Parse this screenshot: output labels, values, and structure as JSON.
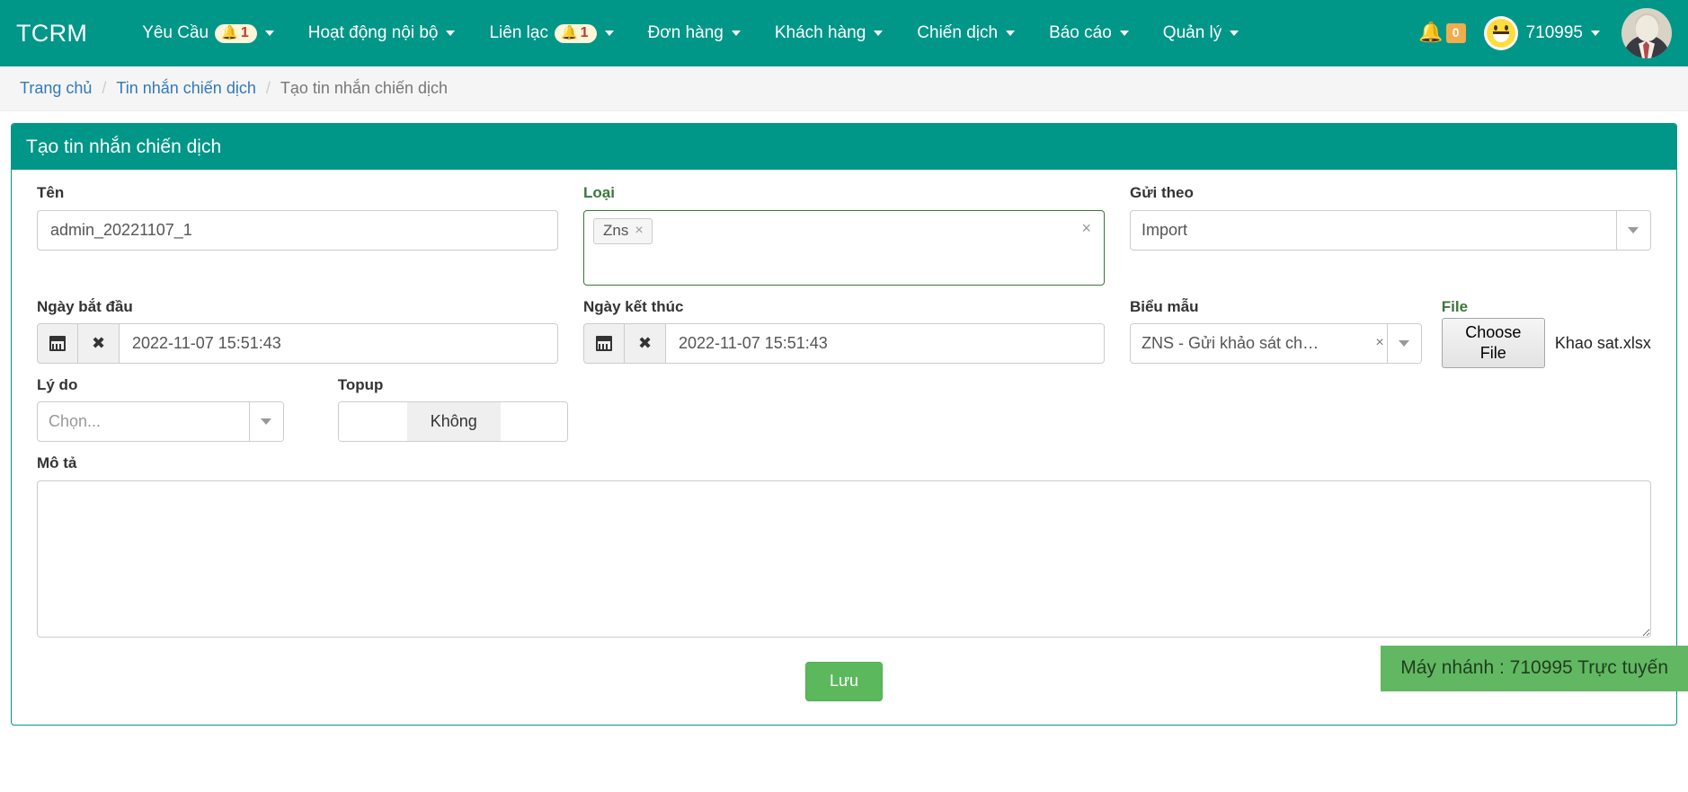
{
  "navbar": {
    "brand": "TCRM",
    "items": [
      {
        "label": "Yêu Cầu",
        "badge": "1",
        "has_badge": true,
        "has_caret": true
      },
      {
        "label": "Hoạt động nội bộ",
        "badge": "",
        "has_badge": false,
        "has_caret": true
      },
      {
        "label": "Liên lạc",
        "badge": "1",
        "has_badge": true,
        "has_caret": true
      },
      {
        "label": "Đơn hàng",
        "badge": "",
        "has_badge": false,
        "has_caret": true
      },
      {
        "label": "Khách hàng",
        "badge": "",
        "has_badge": false,
        "has_caret": true
      },
      {
        "label": "Chiến dịch",
        "badge": "",
        "has_badge": false,
        "has_caret": true
      },
      {
        "label": "Báo cáo",
        "badge": "",
        "has_badge": false,
        "has_caret": true
      },
      {
        "label": "Quản lý",
        "badge": "",
        "has_badge": false,
        "has_caret": true
      }
    ],
    "alert_count": "0",
    "user_name": "710995",
    "colors": {
      "navbar_bg": "#009688",
      "badge_bg": "#fdf6d8",
      "badge_text": "#c0392b",
      "alert_badge_bg": "#f0ad4e"
    }
  },
  "breadcrumb": {
    "home": "Trang chủ",
    "section": "Tin nhắn chiến dịch",
    "current": "Tạo tin nhắn chiến dịch"
  },
  "panel": {
    "title": "Tạo tin nhắn chiến dịch"
  },
  "form": {
    "name": {
      "label": "Tên",
      "value": "admin_20221107_1",
      "placeholder": ""
    },
    "type": {
      "label": "Loại",
      "tag": "Zns",
      "tag_remove": "×",
      "clear": "×"
    },
    "send_by": {
      "label": "Gửi theo",
      "value": "Import"
    },
    "start_date": {
      "label": "Ngày bắt đầu",
      "value": "2022-11-07 15:51:43",
      "calendar_icon": "calendar-icon",
      "clear_icon": "✖"
    },
    "end_date": {
      "label": "Ngày kết thúc",
      "value": "2022-11-07 15:51:43",
      "calendar_icon": "calendar-icon",
      "clear_icon": "✖"
    },
    "template": {
      "label": "Biểu mẫu",
      "value": "ZNS - Gửi khảo sát ch…",
      "clear": "×"
    },
    "file": {
      "label": "File",
      "button": "Choose File",
      "name": "Khao sat.xlsx"
    },
    "reason": {
      "label": "Lý do",
      "placeholder": "Chọn...",
      "value": ""
    },
    "topup": {
      "label": "Topup",
      "state_label": "Không"
    },
    "description": {
      "label": "Mô tả",
      "value": "",
      "placeholder": ""
    },
    "save_button": "Lưu"
  },
  "toast": {
    "message": "Máy nhánh : 710995 Trực tuyến",
    "color": "#62b862"
  }
}
